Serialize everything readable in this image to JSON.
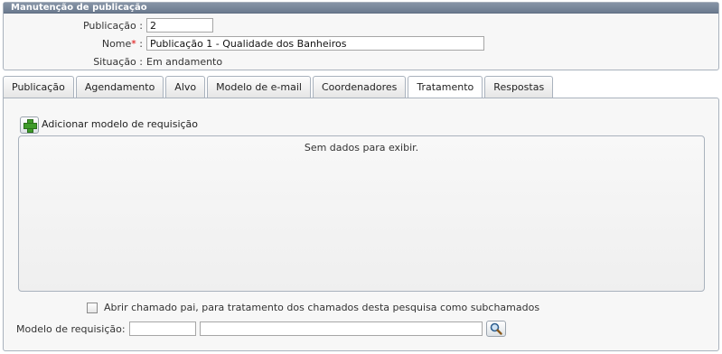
{
  "panel": {
    "title": "Manutenção de publicação"
  },
  "fields": {
    "publicacao": {
      "label": "Publicação :",
      "value": "2"
    },
    "nome": {
      "label": "Nome",
      "required_mark": "*",
      "colon": " :",
      "value": "Publicação 1 - Qualidade dos Banheiros"
    },
    "situacao": {
      "label": "Situação :",
      "value": "Em andamento"
    }
  },
  "tabs": [
    {
      "label": "Publicação"
    },
    {
      "label": "Agendamento"
    },
    {
      "label": "Alvo"
    },
    {
      "label": "Modelo de e-mail"
    },
    {
      "label": "Coordenadores"
    },
    {
      "label": "Tratamento",
      "active": true
    },
    {
      "label": "Respostas"
    }
  ],
  "content": {
    "add_label": "Adicionar modelo de requisição",
    "add_icon": "green-plus-icon",
    "grid_empty_text": "Sem dados para exibir.",
    "checkbox_label": "Abrir chamado pai, para tratamento dos chamados desta pesquisa como subchamados",
    "modelo_label": "Modelo de requisição:",
    "modelo_code": "",
    "modelo_desc": "",
    "lookup_icon": "magnifier-icon"
  }
}
